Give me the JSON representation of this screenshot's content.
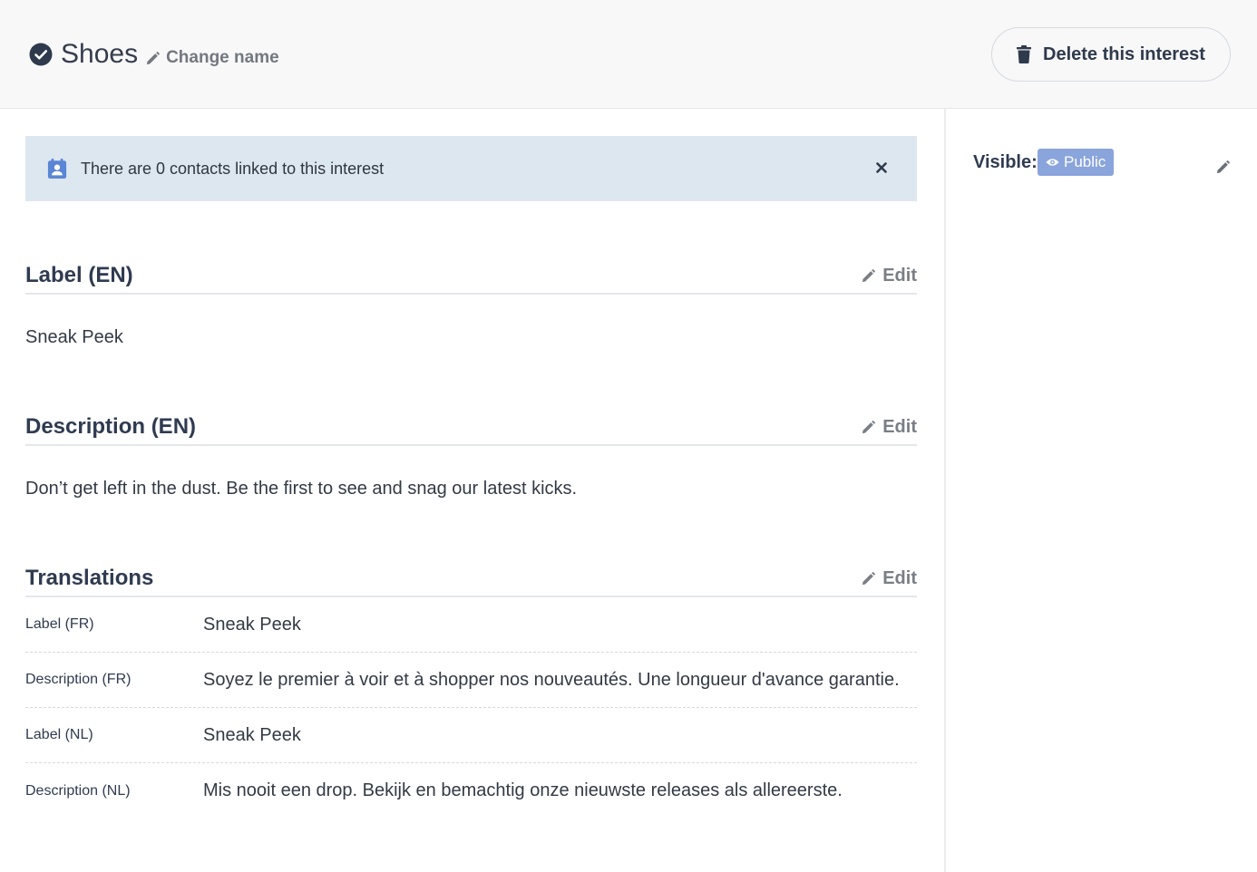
{
  "header": {
    "title": "Shoes",
    "change_name_label": "Change name",
    "delete_label": "Delete this interest"
  },
  "notice": {
    "text": "There are 0 contacts linked to this interest"
  },
  "sections": {
    "label": {
      "title": "Label (EN)",
      "edit_label": "Edit",
      "value": "Sneak Peek"
    },
    "description": {
      "title": "Description (EN)",
      "edit_label": "Edit",
      "value": "Don’t get left in the dust. Be the first to see and snag our latest kicks."
    },
    "translations": {
      "title": "Translations",
      "edit_label": "Edit",
      "rows": [
        {
          "key": "Label (FR)",
          "value": "Sneak Peek"
        },
        {
          "key": "Description (FR)",
          "value": "Soyez le premier à voir et à shopper nos nouveautés. Une longueur d'avance garantie."
        },
        {
          "key": "Label (NL)",
          "value": "Sneak Peek"
        },
        {
          "key": "Description (NL)",
          "value": "Mis nooit een drop. Bekijk en bemachtig onze nieuwste releases als allereerste."
        }
      ]
    }
  },
  "sidebar": {
    "visible_label": "Visible:",
    "visibility_badge": "Public"
  },
  "icons": {
    "title_status": "check-circle-icon",
    "change_name": "pencil-icon",
    "delete": "trash-icon",
    "notice": "contact-card-icon",
    "notice_close": "close-icon",
    "edit": "pencil-icon",
    "badge": "eye-icon"
  },
  "colors": {
    "accent": "#8aa4dc",
    "notice_bg": "#dde7ef",
    "contact_icon": "#5b86d6"
  }
}
